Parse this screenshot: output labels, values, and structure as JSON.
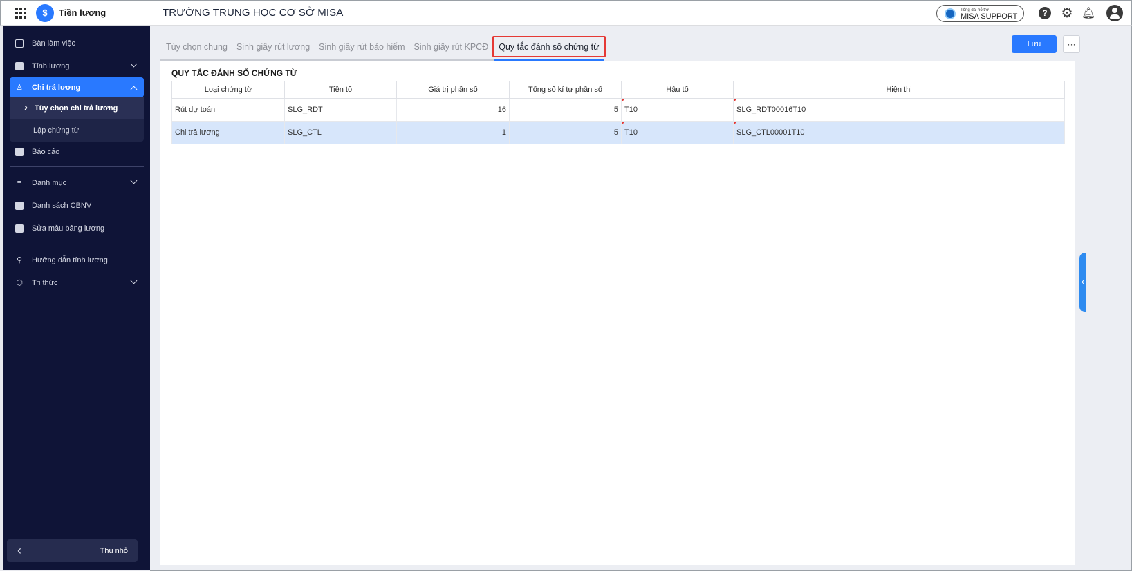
{
  "header": {
    "app_name": "Tiền lương",
    "org_name": "TRƯỜNG TRUNG HỌC CƠ SỞ MISA",
    "support_small": "Tổng đài hỗ trợ",
    "support_label": "MISA SUPPORT",
    "icons": [
      "apps-grid-icon",
      "help-icon",
      "gear-icon",
      "bell-icon",
      "user-icon"
    ]
  },
  "sidebar": {
    "items": [
      {
        "label": "Bàn làm việc",
        "icon": "dashboard-icon"
      },
      {
        "label": "Tính lương",
        "icon": "wallet-icon"
      },
      {
        "label": "Chi trả lương",
        "icon": "payout-icon"
      },
      {
        "label": "Báo cáo",
        "icon": "report-icon"
      },
      {
        "label": "Danh mục",
        "icon": "list-icon"
      },
      {
        "label": "Danh sách CBNV",
        "icon": "staff-icon"
      },
      {
        "label": "Sửa mẫu bảng lương",
        "icon": "template-icon"
      },
      {
        "label": "Hướng dẫn tính lương",
        "icon": "guide-icon"
      },
      {
        "label": "Tri thức",
        "icon": "knowledge-icon"
      }
    ],
    "submenu": [
      {
        "label": "Tùy chọn chi trả lương"
      },
      {
        "label": "Lập chứng từ"
      }
    ],
    "collapse_label": "Thu nhỏ"
  },
  "tabs": [
    {
      "label": "Tùy chọn chung"
    },
    {
      "label": "Sinh giấy rút lương"
    },
    {
      "label": "Sinh giấy rút bảo hiểm"
    },
    {
      "label": "Sinh giấy rút KPCĐ"
    },
    {
      "label": "Quy tắc đánh số chứng từ"
    }
  ],
  "toolbar": {
    "save_label": "Lưu",
    "more_label": "···"
  },
  "section": {
    "title": "QUY TẮC ĐÁNH SỐ CHỨNG TỪ"
  },
  "table": {
    "headers": [
      "Loại chứng từ",
      "Tiền tố",
      "Giá trị phần số",
      "Tổng số kí tự phần số",
      "Hậu tố",
      "Hiện thị"
    ],
    "rows": [
      [
        "Rút dự toán",
        "SLG_RDT",
        "16",
        "5",
        "T10",
        "SLG_RDT00016T10"
      ],
      [
        "Chi trả lương",
        "SLG_CTL",
        "1",
        "5",
        "T10",
        "SLG_CTL00001T10"
      ]
    ]
  },
  "colors": {
    "accent": "#2979ff",
    "sidebar_bg": "#0f1437",
    "highlight": "#e53935",
    "selected_row": "#d7e6fb"
  }
}
